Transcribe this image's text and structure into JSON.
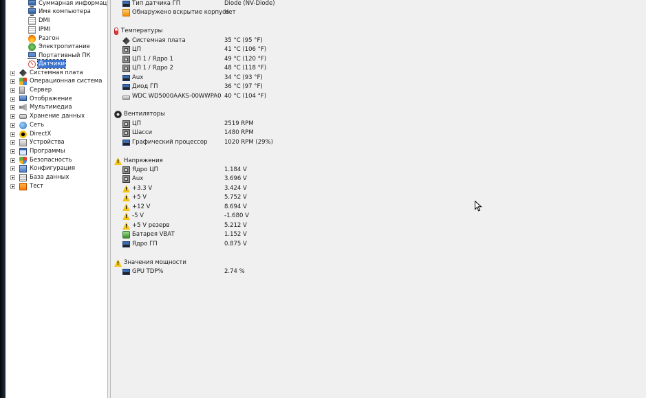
{
  "tree": {
    "children": [
      {
        "label": "Суммарная информация",
        "icon": "monitor-icon"
      },
      {
        "label": "Имя компьютера",
        "icon": "monitor-icon"
      },
      {
        "label": "DMI",
        "icon": "document-icon"
      },
      {
        "label": "IPMI",
        "icon": "document-icon"
      },
      {
        "label": "Разгон",
        "icon": "flame-icon"
      },
      {
        "label": "Электропитание",
        "icon": "power-icon"
      },
      {
        "label": "Портативный ПК",
        "icon": "laptop-icon"
      },
      {
        "label": "Датчики",
        "icon": "sensor-gauge-icon",
        "selected": true
      }
    ],
    "roots": [
      {
        "label": "Системная плата",
        "icon": "motherboard-icon"
      },
      {
        "label": "Операционная система",
        "icon": "windows-icon"
      },
      {
        "label": "Сервер",
        "icon": "server-icon"
      },
      {
        "label": "Отображение",
        "icon": "display-icon"
      },
      {
        "label": "Мультимедиа",
        "icon": "speaker-icon"
      },
      {
        "label": "Хранение данных",
        "icon": "storage-icon"
      },
      {
        "label": "Сеть",
        "icon": "network-icon"
      },
      {
        "label": "DirectX",
        "icon": "directx-icon"
      },
      {
        "label": "Устройства",
        "icon": "devices-icon"
      },
      {
        "label": "Программы",
        "icon": "programs-icon"
      },
      {
        "label": "Безопасность",
        "icon": "security-icon"
      },
      {
        "label": "Конфигурация",
        "icon": "configuration-icon"
      },
      {
        "label": "База данных",
        "icon": "database-icon"
      },
      {
        "label": "Тест",
        "icon": "benchmark-icon"
      }
    ]
  },
  "content": {
    "top_rows": [
      {
        "name": "Тип датчика ГП",
        "value": "Diode  (NV-Diode)",
        "icon": "gpu-icon"
      },
      {
        "name": "Обнаружено вскрытие корпуса",
        "value": "Нет",
        "icon": "case-icon"
      }
    ],
    "sections": [
      {
        "title": "Температуры",
        "icon": "thermometer-icon",
        "rows": [
          {
            "name": "Системная плата",
            "value": "35 °C  (95 °F)",
            "icon": "motherboard-icon"
          },
          {
            "name": "ЦП",
            "value": "41 °C  (106 °F)",
            "icon": "cpu-icon"
          },
          {
            "name": "ЦП 1 / Ядро 1",
            "value": "49 °C  (120 °F)",
            "icon": "cpu-icon"
          },
          {
            "name": "ЦП 1 / Ядро 2",
            "value": "48 °C  (118 °F)",
            "icon": "cpu-icon"
          },
          {
            "name": "Aux",
            "value": "34 °C  (93 °F)",
            "icon": "network-adapter-icon"
          },
          {
            "name": "Диод ГП",
            "value": "36 °C  (97 °F)",
            "icon": "gpu-icon"
          },
          {
            "name": "WDC WD5000AAKS-00WWPA0",
            "value": "40 °C  (104 °F)",
            "icon": "hard-drive-icon"
          }
        ]
      },
      {
        "title": "Вентиляторы",
        "icon": "fan-icon",
        "rows": [
          {
            "name": "ЦП",
            "value": "2519 RPM",
            "icon": "cpu-icon"
          },
          {
            "name": "Шасси",
            "value": "1480 RPM",
            "icon": "cpu-icon"
          },
          {
            "name": "Графический процессор",
            "value": "1020 RPM  (29%)",
            "icon": "gpu-icon"
          }
        ]
      },
      {
        "title": "Напряжения",
        "icon": "warning-icon",
        "rows": [
          {
            "name": "Ядро ЦП",
            "value": "1.184 V",
            "icon": "cpu-icon"
          },
          {
            "name": "Aux",
            "value": "3.696 V",
            "icon": "cpu-icon"
          },
          {
            "name": "+3.3 V",
            "value": "3.424 V",
            "icon": "warning-icon"
          },
          {
            "name": "+5 V",
            "value": "5.752 V",
            "icon": "warning-icon"
          },
          {
            "name": "+12 V",
            "value": "8.694 V",
            "icon": "warning-icon"
          },
          {
            "name": "-5 V",
            "value": "-1.680 V",
            "icon": "warning-icon"
          },
          {
            "name": "+5 V резерв",
            "value": "5.212 V",
            "icon": "warning-icon"
          },
          {
            "name": "Батарея VBAT",
            "value": "1.152 V",
            "icon": "battery-icon"
          },
          {
            "name": "Ядро ГП",
            "value": "0.875 V",
            "icon": "gpu-icon"
          }
        ]
      },
      {
        "title": "Значения мощности",
        "icon": "warning-icon",
        "rows": [
          {
            "name": "GPU TDP%",
            "value": "2.74 %",
            "icon": "gpu-icon"
          }
        ]
      }
    ]
  }
}
